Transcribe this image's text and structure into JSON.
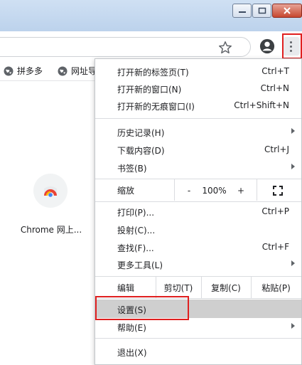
{
  "bookmarks": {
    "items": [
      {
        "label": "拼多多",
        "icon": "globe-icon"
      },
      {
        "label": "网址导",
        "icon": "globe-icon"
      }
    ]
  },
  "ntp": {
    "tile_label": "Chrome 网上..."
  },
  "menu": {
    "group1": [
      {
        "label": "打开新的标签页(T)",
        "shortcut": "Ctrl+T"
      },
      {
        "label": "打开新的窗口(N)",
        "shortcut": "Ctrl+N"
      },
      {
        "label": "打开新的无痕窗口(I)",
        "shortcut": "Ctrl+Shift+N"
      }
    ],
    "group2": [
      {
        "label": "历史记录(H)",
        "shortcut": ""
      },
      {
        "label": "下载内容(D)",
        "shortcut": "Ctrl+J"
      },
      {
        "label": "书签(B)",
        "shortcut": ""
      }
    ],
    "zoom": {
      "label": "缩放",
      "minus": "-",
      "value": "100%",
      "plus": "+"
    },
    "group3": [
      {
        "label": "打印(P)...",
        "shortcut": "Ctrl+P"
      },
      {
        "label": "投射(C)...",
        "shortcut": ""
      },
      {
        "label": "查找(F)...",
        "shortcut": "Ctrl+F"
      },
      {
        "label": "更多工具(L)",
        "shortcut": ""
      }
    ],
    "edit": {
      "label": "编辑",
      "cut": "剪切(T)",
      "copy": "复制(C)",
      "paste": "粘贴(P)"
    },
    "settings": {
      "label": "设置(S)"
    },
    "help": {
      "label": "帮助(E)"
    },
    "exit": {
      "label": "退出(X)"
    }
  },
  "colors": {
    "highlight_box": "#e02020",
    "hover_row": "#cfcfcf"
  }
}
